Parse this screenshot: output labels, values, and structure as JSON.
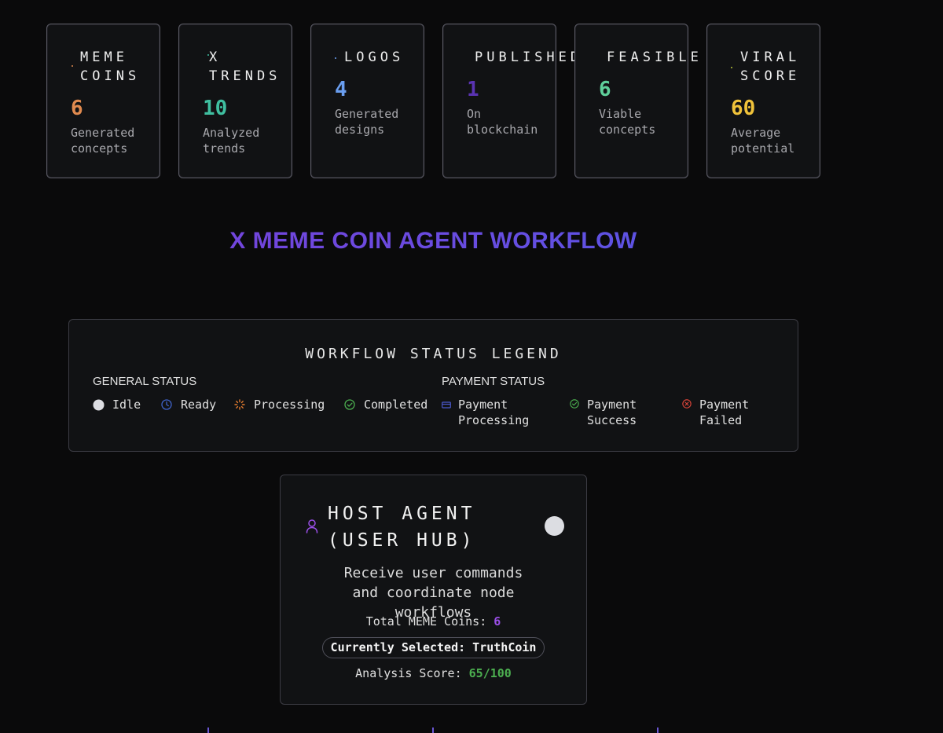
{
  "stats": [
    {
      "title": "MEME COINS",
      "value": "6",
      "caption": "Generated concepts",
      "value_color": "#e08a4f",
      "dot_color": "#e08a4f"
    },
    {
      "title": "X TRENDS",
      "value": "10",
      "caption": "Analyzed trends",
      "value_color": "#3fbfa0",
      "dot_color": "#3fbfa0"
    },
    {
      "title": "LOGOS",
      "value": "4",
      "caption": "Generated designs",
      "value_color": "#6a9ef0",
      "dot_color": "#6a9ef0"
    },
    {
      "title": "PUBLISHED",
      "value": "1",
      "caption": "On blockchain",
      "value_color": "#5a33b3",
      "dot_color": "#5a33b3"
    },
    {
      "title": "FEASIBLE",
      "value": "6",
      "caption": "Viable concepts",
      "value_color": "#5fcf9a",
      "dot_color": "#5fcf9a"
    },
    {
      "title": "VIRAL SCORE",
      "value": "60",
      "caption": "Average potential",
      "value_color": "#f0c23a",
      "dot_color": "#b8c23a"
    }
  ],
  "workflow_title": "X MEME COIN AGENT WORKFLOW",
  "legend": {
    "title": "WORKFLOW STATUS LEGEND",
    "general_title": "GENERAL STATUS",
    "payment_title": "PAYMENT STATUS",
    "general": [
      {
        "label": "Idle",
        "icon": "idle-dot-icon",
        "color": "#dcdde2"
      },
      {
        "label": "Ready",
        "icon": "clock-icon",
        "color": "#3f63c9"
      },
      {
        "label": "Processing",
        "icon": "spinner-icon",
        "color": "#e07a2f"
      },
      {
        "label": "Completed",
        "icon": "check-circle-icon",
        "color": "#4caf50"
      }
    ],
    "payment": [
      {
        "label": "Payment Processing",
        "icon": "card-icon",
        "color": "#4a58c9"
      },
      {
        "label": "Payment Success",
        "icon": "check-circle-icon",
        "color": "#4caf50"
      },
      {
        "label": "Payment Failed",
        "icon": "x-circle-icon",
        "color": "#e0453a"
      }
    ]
  },
  "host": {
    "title": "HOST AGENT (USER HUB)",
    "description": "Receive user commands and coordinate node workflows",
    "total_label": "Total MEME Coins:",
    "total_value": "6",
    "selected": "Currently Selected: TruthCoin",
    "score_label": "Analysis Score:",
    "score_value": "65/100",
    "status": "idle",
    "icon": "user-icon"
  }
}
